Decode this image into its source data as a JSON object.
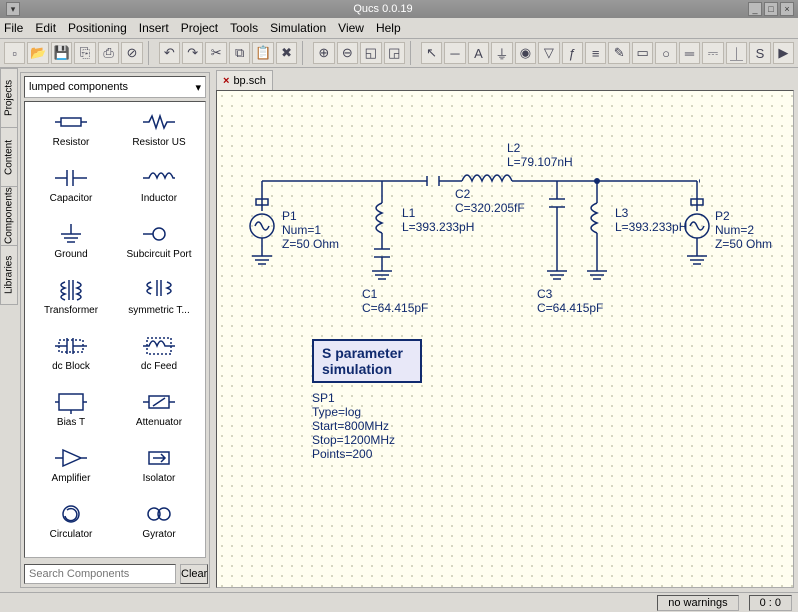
{
  "title": "Qucs 0.0.19",
  "menu": [
    "File",
    "Edit",
    "Positioning",
    "Insert",
    "Project",
    "Tools",
    "Simulation",
    "View",
    "Help"
  ],
  "toolbar_icons": [
    "new",
    "open",
    "save",
    "saveall",
    "print",
    "close",
    "|",
    "undo",
    "redo",
    "cut",
    "copy",
    "paste",
    "delete",
    "|",
    "zoomin",
    "zoomout",
    "zoomfit",
    "zoomsel",
    "|",
    "pointer",
    "wire",
    "label",
    "ground",
    "port",
    "marker",
    "eqn",
    "ruler",
    "pen",
    "rect",
    "ellipse",
    "bus",
    "vsrc",
    "gnd2",
    "sparam",
    "sim"
  ],
  "sidetabs": [
    "Projects",
    "Content",
    "Components",
    "Libraries"
  ],
  "component_category": "lumped components",
  "components": [
    "Resistor",
    "Resistor US",
    "Capacitor",
    "Inductor",
    "Ground",
    "Subcircuit Port",
    "Transformer",
    "symmetric T...",
    "dc Block",
    "dc Feed",
    "Bias T",
    "Attenuator",
    "Amplifier",
    "Isolator",
    "Circulator",
    "Gyrator"
  ],
  "search_placeholder": "Search Components",
  "clear_label": "Clear",
  "tab_name": "bp.sch",
  "schematic": {
    "P1": {
      "name": "P1",
      "l1": "Num=1",
      "l2": "Z=50 Ohm"
    },
    "P2": {
      "name": "P2",
      "l1": "Num=2",
      "l2": "Z=50 Ohm"
    },
    "L1": {
      "name": "L1",
      "val": "L=393.233pH"
    },
    "L2": {
      "name": "L2",
      "val": "L=79.107nH"
    },
    "L3": {
      "name": "L3",
      "val": "L=393.233pH"
    },
    "C1": {
      "name": "C1",
      "val": "C=64.415pF"
    },
    "C2": {
      "name": "C2",
      "val": "C=320.205fF"
    },
    "C3": {
      "name": "C3",
      "val": "C=64.415pF"
    }
  },
  "simbox": {
    "l1": "S parameter",
    "l2": "simulation"
  },
  "simparams": {
    "name": "SP1",
    "type": "Type=log",
    "start": "Start=800MHz",
    "stop": "Stop=1200MHz",
    "points": "Points=200"
  },
  "status": {
    "warn": "no warnings",
    "coord": "0 : 0"
  }
}
